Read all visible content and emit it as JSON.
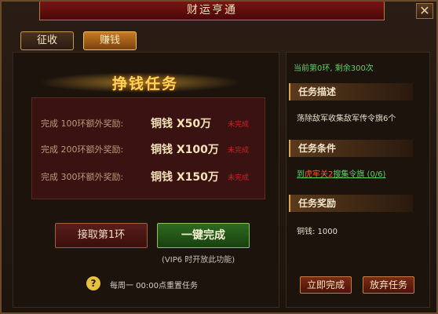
{
  "window": {
    "title": "财运亨通",
    "close_label": "✕"
  },
  "tabs": [
    {
      "label": "征收"
    },
    {
      "label": "赚钱"
    }
  ],
  "main": {
    "heading": "挣钱任务",
    "rewards": [
      {
        "label": "完成 100环额外奖励:",
        "amount": "铜钱 X50万",
        "status": "未完成"
      },
      {
        "label": "完成 200环额外奖励:",
        "amount": "铜钱 X100万",
        "status": "未完成"
      },
      {
        "label": "完成 300环额外奖励:",
        "amount": "铜钱 X150万",
        "status": "未完成"
      }
    ],
    "claim_button": "接取第1环",
    "complete_all_button": "一键完成",
    "vip_note": "(VIP6 时开放此功能)",
    "help_icon": "?",
    "reset_note": "每周一  00:00点重置任务"
  },
  "side": {
    "progress": "当前第0环, 剩余300次",
    "desc_title": "任务描述",
    "desc_text": "荡除敌军收集敌军传令旗6个",
    "cond_title": "任务条件",
    "cond_prefix": "到",
    "cond_place": "虎牢关2",
    "cond_suffix": "搜集令旗 (0/6)",
    "reward_title": "任务奖励",
    "reward_text": "铜钱: 1000",
    "complete_now": "立即完成",
    "abandon": "放弃任务"
  }
}
